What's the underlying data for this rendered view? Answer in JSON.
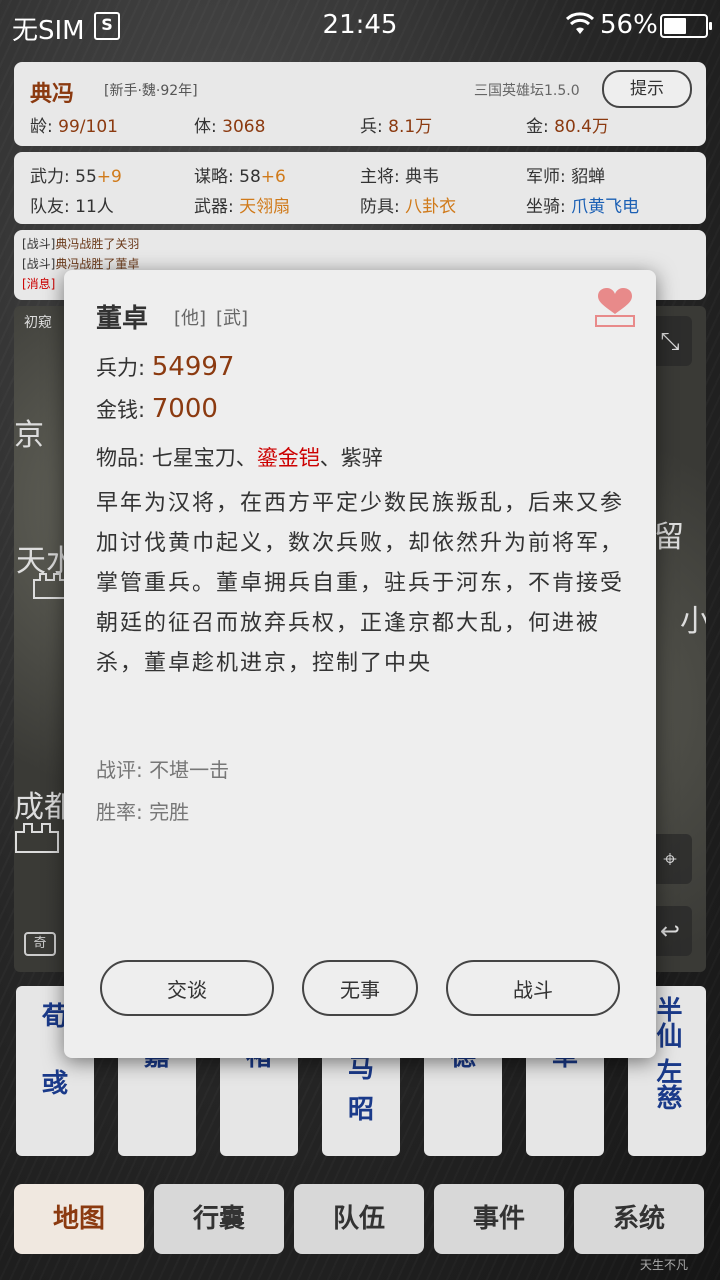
{
  "status_bar": {
    "carrier": "无SIM",
    "sim_icon": "S",
    "time": "21:45",
    "battery": "56%"
  },
  "header": {
    "name": "典冯",
    "tag": "[新手·魏·92年]",
    "version": "三国英雄坛1.5.0",
    "hint_label": "提示",
    "stats": [
      {
        "label": "龄",
        "value": "99/101"
      },
      {
        "label": "体",
        "value": "3068"
      },
      {
        "label": "兵",
        "value": "8.1万"
      },
      {
        "label": "金",
        "value": "80.4万"
      }
    ]
  },
  "attributes": {
    "row1": [
      {
        "label": "武力",
        "value": "55",
        "extra": "+9"
      },
      {
        "label": "谋略",
        "value": "58",
        "extra": "+6"
      },
      {
        "label": "主将",
        "value": "典韦"
      },
      {
        "label": "军师",
        "value": "貂蝉"
      }
    ],
    "row2": [
      {
        "label": "队友",
        "value": "11人"
      },
      {
        "label": "武器",
        "value": "天翎扇"
      },
      {
        "label": "防具",
        "value": "八卦衣"
      },
      {
        "label": "坐骑",
        "value": "爪黄飞电"
      }
    ]
  },
  "log": [
    {
      "type": "[战斗]",
      "text_a": "典冯战胜了",
      "text_b": "关羽"
    },
    {
      "type": "[战斗]",
      "text_a": "典冯战胜了",
      "text_b": "董卓"
    },
    {
      "type": "[消息]",
      "text_a": "",
      "text_b": ""
    }
  ],
  "map": {
    "label": "初窥",
    "places": [
      "京",
      "天水",
      "留",
      "小",
      "成都"
    ],
    "badge": "奇"
  },
  "cards": [
    {
      "line1": "荀",
      "line2": "彧"
    },
    {
      "line1": "",
      "line2": "嘉"
    },
    {
      "line1": "",
      "line2": "褚"
    },
    {
      "line1": "马",
      "line2": "昭"
    },
    {
      "line1": "",
      "line2": "德"
    },
    {
      "line1": "",
      "line2": "卓"
    },
    {
      "line1": "半仙",
      "line2": "左慈"
    }
  ],
  "nav": [
    "地图",
    "行囊",
    "队伍",
    "事件",
    "系统"
  ],
  "footer_note": "天生不凡",
  "modal": {
    "name": "董卓",
    "tag1": "[他]",
    "tag2": "[武]",
    "troops_label": "兵力:",
    "troops": "54997",
    "money_label": "金钱:",
    "money": "7000",
    "items_label": "物品:",
    "item1": "七星宝刀、",
    "item2": "鎏金铠",
    "item3": "、紫骍",
    "description": "早年为汉将，在西方平定少数民族叛乱，后来又参加讨伐黄巾起义，数次兵败，却依然升为前将军，掌管重兵。董卓拥兵自重，驻兵于河东，不肯接受朝廷的征召而放弃兵权，正逢京都大乱，何进被杀，董卓趁机进京，控制了中央",
    "review": "战评: 不堪一击",
    "winrate": "胜率: 完胜",
    "btn_talk": "交谈",
    "btn_none": "无事",
    "btn_fight": "战斗"
  },
  "colors": {
    "accent": "#8b3a10",
    "blue": "#1a5fb4",
    "orange": "#d07a1a",
    "red": "#cc0000"
  }
}
